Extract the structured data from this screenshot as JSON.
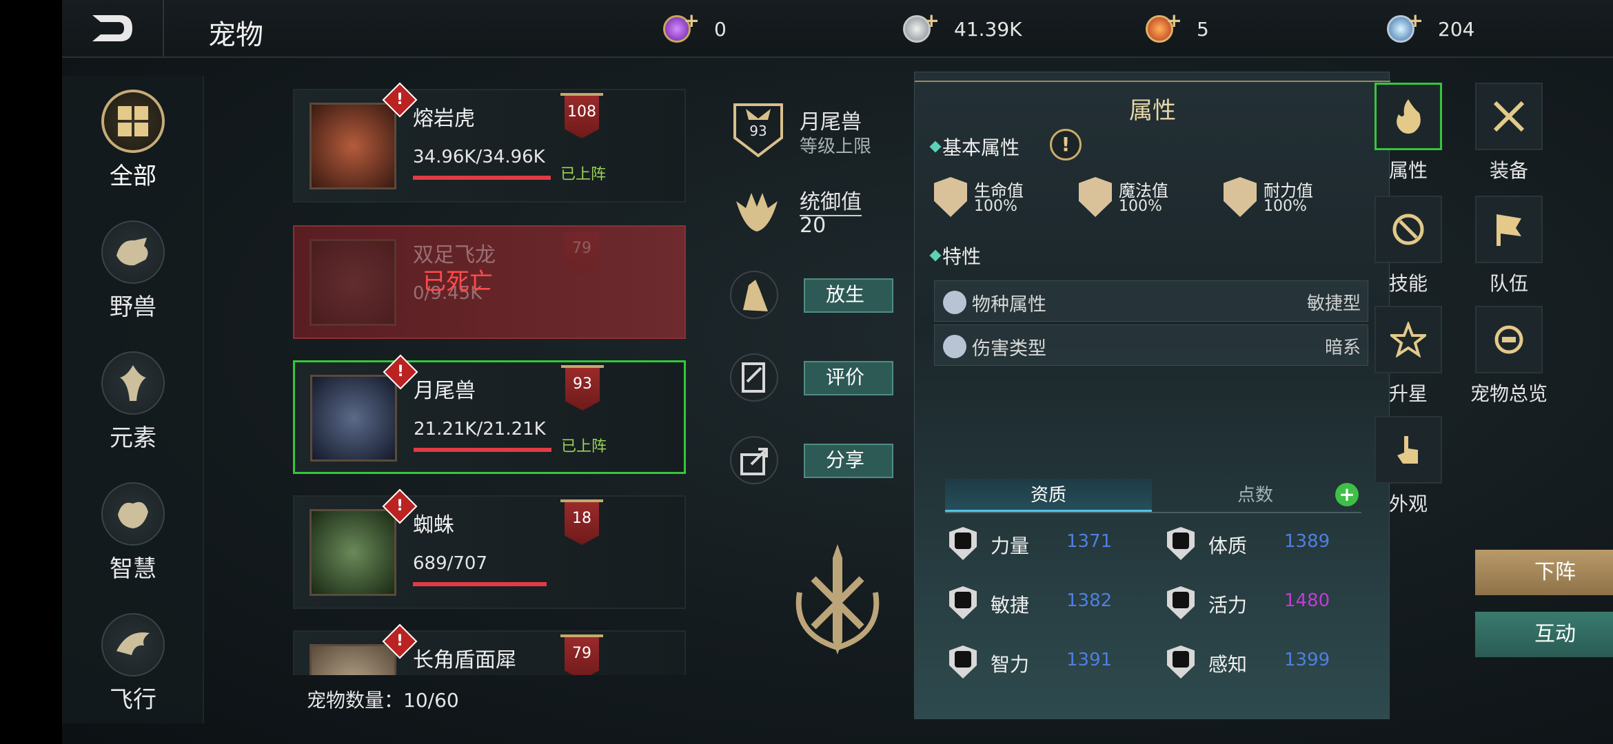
{
  "header": {
    "title": "宠物",
    "resources": [
      {
        "icon": "purple-gem-icon",
        "value": "0"
      },
      {
        "icon": "silver-coin-icon",
        "value": "41.39K"
      },
      {
        "icon": "orange-medal-icon",
        "value": "5"
      },
      {
        "icon": "blue-crystal-icon",
        "value": "204"
      }
    ]
  },
  "categories": [
    {
      "label": "全部",
      "icon": "grid-icon",
      "active": true
    },
    {
      "label": "野兽",
      "icon": "beast-icon",
      "active": false
    },
    {
      "label": "元素",
      "icon": "element-icon",
      "active": false
    },
    {
      "label": "智慧",
      "icon": "wisdom-icon",
      "active": false
    },
    {
      "label": "飞行",
      "icon": "flying-icon",
      "active": false
    }
  ],
  "pets": [
    {
      "name": "熔岩虎",
      "hp": "34.96K/34.96K",
      "level": "108",
      "status": "已上阵",
      "hp_fraction": 1.0
    },
    {
      "name": "双足飞龙",
      "hp": "0/9.45K",
      "level": "79",
      "status": "已死亡",
      "hp_fraction": 0.0
    },
    {
      "name": "月尾兽",
      "hp": "21.21K/21.21K",
      "level": "93",
      "status": "已上阵",
      "hp_fraction": 1.0
    },
    {
      "name": "蜘蛛",
      "hp": "689/707",
      "level": "18",
      "status": "",
      "hp_fraction": 0.97
    },
    {
      "name": "长角盾面犀",
      "hp": "",
      "level": "79",
      "status": "",
      "hp_fraction": 0
    }
  ],
  "pet_count_label": "宠物数量：",
  "pet_count_value": "10/60",
  "detail": {
    "level_badge": "93",
    "name": "月尾兽",
    "level_hint": "等级上限",
    "command_label": "统御值",
    "command_value": "20",
    "btn_release": "放生",
    "btn_rate": "评价",
    "btn_share": "分享"
  },
  "attributes": {
    "title": "属性",
    "basic_title": "基本属性",
    "basic": [
      {
        "name": "生命值",
        "value": "100%"
      },
      {
        "name": "魔法值",
        "value": "100%"
      },
      {
        "name": "耐力值",
        "value": "100%"
      }
    ],
    "traits_title": "特性",
    "traits": [
      {
        "key": "物种属性",
        "value": "敏捷型"
      },
      {
        "key": "伤害类型",
        "value": "暗系"
      }
    ],
    "tab_quality": "资质",
    "tab_points": "点数",
    "add_symbol": "+",
    "stats": [
      {
        "name": "力量",
        "value": "1371",
        "color": "#4f7fe0"
      },
      {
        "name": "体质",
        "value": "1389",
        "color": "#4f7fe0"
      },
      {
        "name": "敏捷",
        "value": "1382",
        "color": "#4f7fe0"
      },
      {
        "name": "活力",
        "value": "1480",
        "color": "#c23bd8"
      },
      {
        "name": "智力",
        "value": "1391",
        "color": "#4f7fe0"
      },
      {
        "name": "感知",
        "value": "1399",
        "color": "#4f7fe0"
      }
    ]
  },
  "menu": [
    {
      "label": "属性",
      "icon": "flame-icon",
      "active": true
    },
    {
      "label": "装备",
      "icon": "crossed-swords-icon",
      "active": false
    },
    {
      "label": "技能",
      "icon": "skill-icon",
      "active": false
    },
    {
      "label": "队伍",
      "icon": "flag-icon",
      "active": false
    },
    {
      "label": "升星",
      "icon": "star-icon",
      "active": false
    },
    {
      "label": "宠物总览",
      "icon": "overview-icon",
      "active": false
    },
    {
      "label": "外观",
      "icon": "hand-pointer-icon",
      "active": false
    }
  ],
  "btn_dismiss": "下阵",
  "btn_interact": "互动"
}
